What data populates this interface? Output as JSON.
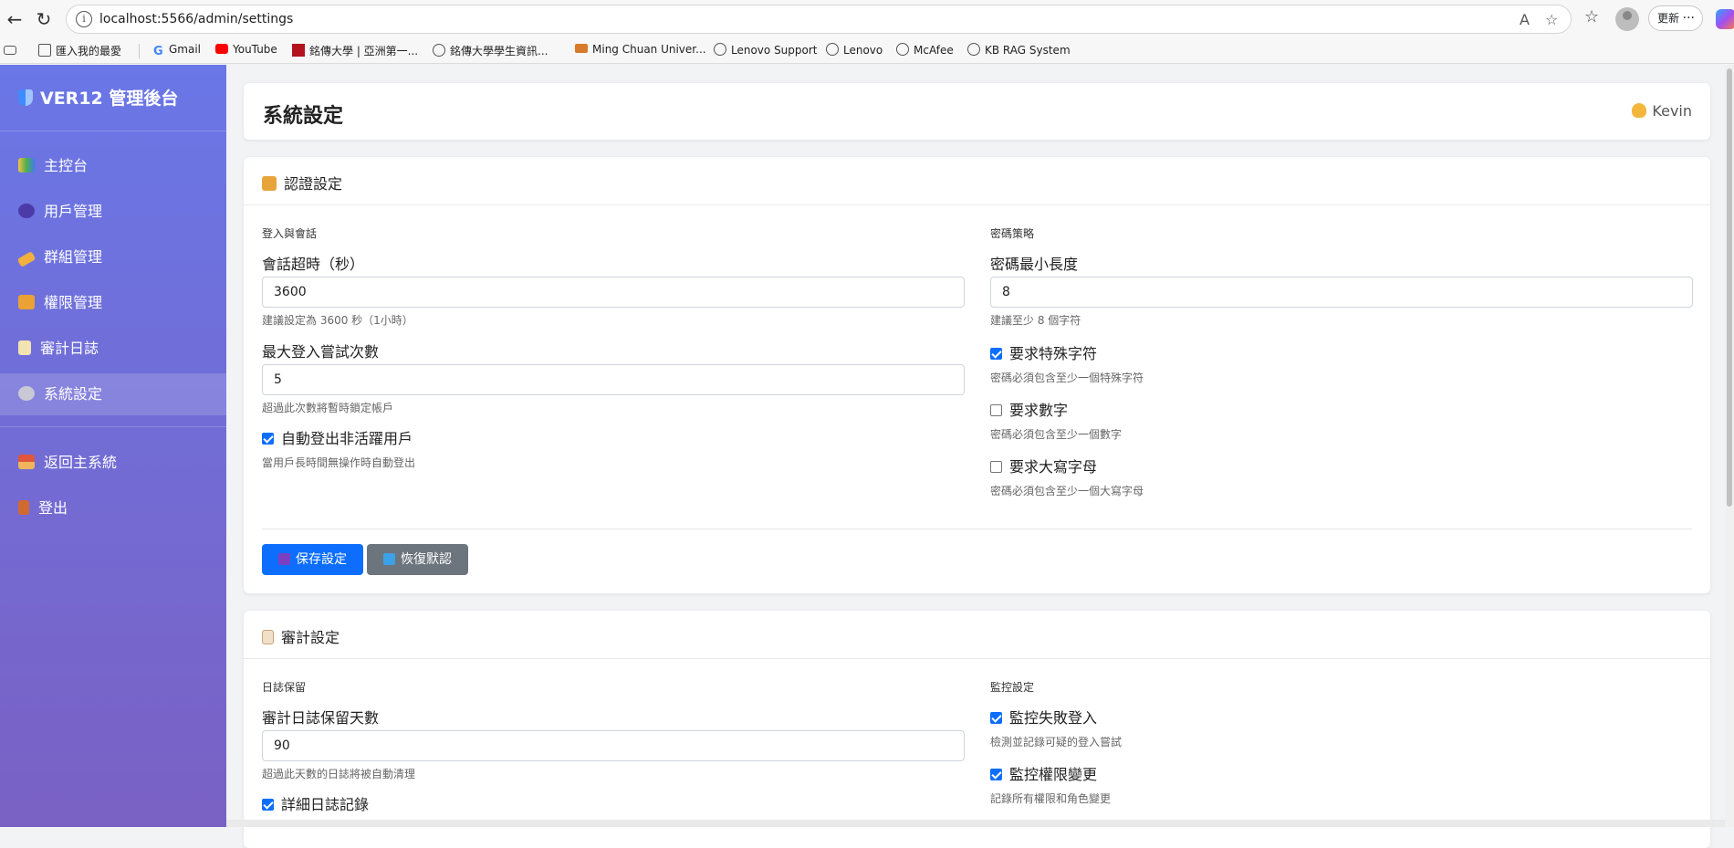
{
  "browser": {
    "url": "localhost:5566/admin/settings",
    "update_label": "更新",
    "bookmarks": [
      {
        "label": "匯入我的最愛",
        "icon": "import-icon"
      },
      {
        "label": "Gmail",
        "icon": "google-icon"
      },
      {
        "label": "YouTube",
        "icon": "youtube-icon"
      },
      {
        "label": "銘傳大學 | 亞洲第一...",
        "icon": "mcu-icon"
      },
      {
        "label": "銘傳大學學生資訊...",
        "icon": "globe-icon"
      },
      {
        "label": "Ming Chuan Univer...",
        "icon": "mcu-alt-icon"
      },
      {
        "label": "Lenovo Support",
        "icon": "globe-icon"
      },
      {
        "label": "Lenovo",
        "icon": "globe-icon"
      },
      {
        "label": "McAfee",
        "icon": "globe-icon"
      },
      {
        "label": "KB RAG System",
        "icon": "globe-icon"
      }
    ]
  },
  "sidebar": {
    "brand": "VER12 管理後台",
    "items": [
      {
        "label": "主控台",
        "icon": "dashboard-icon"
      },
      {
        "label": "用戶管理",
        "icon": "users-icon"
      },
      {
        "label": "群組管理",
        "icon": "tag-icon"
      },
      {
        "label": "權限管理",
        "icon": "lock-icon"
      },
      {
        "label": "審計日誌",
        "icon": "log-icon"
      },
      {
        "label": "系統設定",
        "icon": "gear-icon"
      },
      {
        "label": "返回主系統",
        "icon": "home-icon"
      },
      {
        "label": "登出",
        "icon": "door-icon"
      }
    ]
  },
  "header": {
    "title": "系統設定",
    "user": "Kevin"
  },
  "auth": {
    "title": "認證設定",
    "left_section": "登入與會話",
    "session_label": "會話超時（秒）",
    "session_value": "3600",
    "session_help": "建議設定為 3600 秒（1小時）",
    "attempts_label": "最大登入嘗試次數",
    "attempts_value": "5",
    "attempts_help": "超過此次數將暫時鎖定帳戶",
    "autologout_label": "自動登出非活躍用戶",
    "autologout_checked": true,
    "autologout_help": "當用戶長時間無操作時自動登出",
    "right_section": "密碼策略",
    "minlen_label": "密碼最小長度",
    "minlen_value": "8",
    "minlen_help": "建議至少 8 個字符",
    "special_label": "要求特殊字符",
    "special_checked": true,
    "special_help": "密碼必須包含至少一個特殊字符",
    "digit_label": "要求數字",
    "digit_checked": false,
    "digit_help": "密碼必須包含至少一個數字",
    "upper_label": "要求大寫字母",
    "upper_checked": false,
    "upper_help": "密碼必須包含至少一個大寫字母",
    "save_label": "保存設定",
    "reset_label": "恢復默認"
  },
  "audit": {
    "title": "審計設定",
    "left_section": "日誌保留",
    "retention_label": "審計日誌保留天數",
    "retention_value": "90",
    "retention_help": "超過此天數的日誌將被自動清理",
    "detailed_label": "詳細日誌記錄",
    "detailed_checked": true,
    "right_section": "監控設定",
    "failed_label": "監控失敗登入",
    "failed_checked": true,
    "failed_help": "檢測並記錄可疑的登入嘗試",
    "perm_label": "監控權限變更",
    "perm_checked": true,
    "perm_help": "記錄所有權限和角色變更"
  },
  "colors": {
    "primary": "#0d6efd",
    "secondary": "#6c757d",
    "sidebar_top": "#6a77e6",
    "sidebar_bottom": "#7a61c4"
  }
}
